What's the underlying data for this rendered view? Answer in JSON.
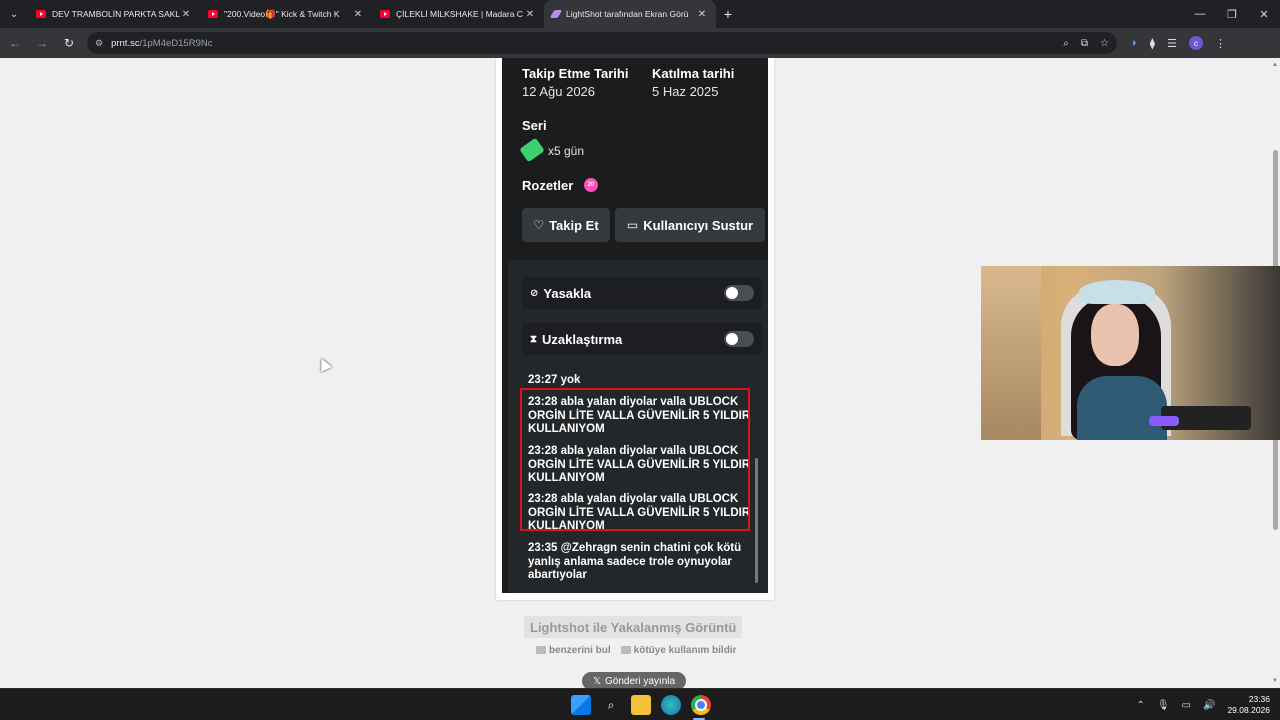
{
  "tabs": [
    {
      "title": "DEV TRAMBOLİN PARKTA SAKL"
    },
    {
      "title": "\"200.Video🎁\" Kick & Twitch K"
    },
    {
      "title": "ÇİLEKLİ MİLKSHAKE | Madara C"
    },
    {
      "title": "LightShot tarafından Ekran Görü"
    }
  ],
  "address": {
    "host": "prnt.sc",
    "path": "/1pM4eD15R9Nc"
  },
  "profile_initial": "c",
  "screenshot": {
    "follow_date_label": "Takip Etme Tarihi",
    "follow_date_value": "12 Ağu 2026",
    "join_date_label": "Katılma tarihi",
    "join_date_value": "5 Haz 2025",
    "streak_label": "Seri",
    "streak_value": "x5 gün",
    "badges_label": "Rozetler",
    "badge_value": "20",
    "follow_button": "Takip Et",
    "mute_button": "Kullanıcıyı Sustur",
    "ban_label": "Yasakla",
    "timeout_label": "Uzaklaştırma",
    "messages": [
      "23:27 yok",
      "23:28 abla yalan diyolar valla UBLOCK ORGİN LİTE VALLA GÜVENİLİR 5 YILDIR KULLANIYOM",
      "23:28 abla yalan diyolar valla UBLOCK ORGİN LİTE VALLA GÜVENİLİR 5 YILDIR KULLANIYOM",
      "23:28 abla yalan diyolar valla UBLOCK ORGİN LİTE VALLA GÜVENİLİR 5 YILDIR KULLANIYOM",
      "23:35 @Zehragn senin chatini çok kötü yanlış anlama sadece trole oynuyolar abartıyolar"
    ]
  },
  "caption": "Lightshot ile Yakalanmış Görüntü",
  "links": {
    "similar": "benzerini bul",
    "report": "kötüye kullanım bildir"
  },
  "post_button": "Gönderi yayınla",
  "clock": {
    "time": "23:36",
    "date": "29.08.2026"
  }
}
